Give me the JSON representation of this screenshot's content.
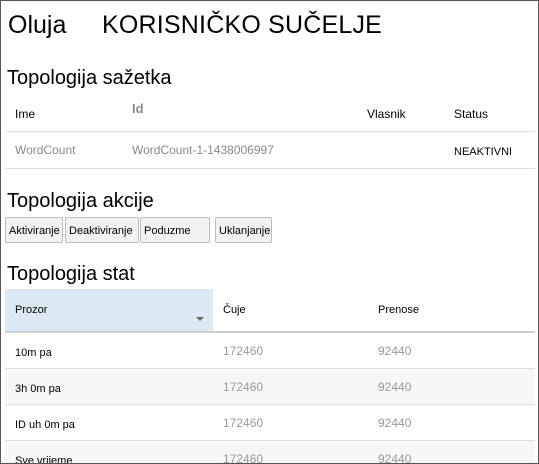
{
  "header": {
    "app_name": "Oluja",
    "app_title": "KORISNIČKO SUČELJE"
  },
  "summary": {
    "title": "Topologija sažetka",
    "columns": [
      "Ime",
      "Id",
      "Vlasnik",
      "Status"
    ],
    "rows": [
      {
        "name": "WordCount",
        "id": "WordCount-1-1438006997",
        "owner": "",
        "status": "NEAKTIVNI"
      }
    ]
  },
  "actions": {
    "title": "Topologija akcije",
    "buttons": [
      "Aktiviranje",
      "Deaktiviranje",
      "Poduzme",
      "Uklanjanje"
    ]
  },
  "stats": {
    "title": "Topologija stat",
    "columns": [
      "Prozor",
      "Čuje",
      "Prenose"
    ],
    "sorted_column": "Prozor",
    "rows": [
      {
        "window": "10m pa",
        "emitted": "172460",
        "transferred": "92440"
      },
      {
        "window": "3h 0m pa",
        "emitted": "172460",
        "transferred": "92440"
      },
      {
        "window": "ID uh 0m pa",
        "emitted": "172460",
        "transferred": "92440"
      },
      {
        "window": "Sve vrijeme",
        "emitted": "172460",
        "transferred": "92440"
      }
    ]
  },
  "colors": {
    "sorted_header_bg": "#dce9f4",
    "button_bg": "#f2f2f2",
    "muted_text": "#888888"
  }
}
